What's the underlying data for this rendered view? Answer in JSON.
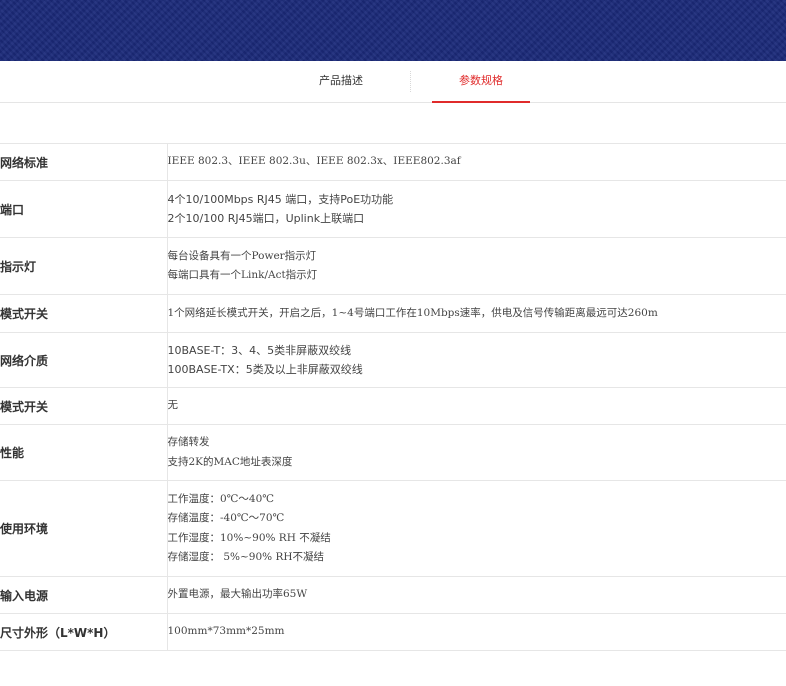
{
  "tabs": {
    "description": "产品描述",
    "specs": "参数规格"
  },
  "specs": [
    {
      "label": "网络标准",
      "lines": [
        "IEEE 802.3、IEEE 802.3u、IEEE 802.3x、IEEE802.3af"
      ]
    },
    {
      "label": "端口",
      "lines": [
        "4个10/100Mbps RJ45 端口，支持PoE功功能",
        "2个10/100 RJ45端口，Uplink上联端口"
      ]
    },
    {
      "label": "指示灯",
      "lines": [
        "每台设备具有一个Power指示灯",
        "每端口具有一个Link/Act指示灯"
      ]
    },
    {
      "label": "模式开关",
      "lines": [
        "1个网络延长模式开关，开启之后，1~4号端口工作在10Mbps速率，供电及信号传输距离最远可达260m"
      ]
    },
    {
      "label": "网络介质",
      "lines": [
        "10BASE-T：3、4、5类非屏蔽双绞线",
        "100BASE-TX：5类及以上非屏蔽双绞线"
      ]
    },
    {
      "label": "模式开关",
      "lines": [
        "无"
      ]
    },
    {
      "label": "性能",
      "lines": [
        "存储转发",
        "支持2K的MAC地址表深度"
      ]
    },
    {
      "label": "使用环境",
      "lines": [
        "工作温度：0℃～40℃",
        "存储温度：-40℃～70℃",
        "工作湿度：10%~90% RH 不凝结",
        "存储湿度： 5%~90% RH不凝结"
      ]
    },
    {
      "label": "输入电源",
      "lines": [
        "外置电源，最大输出功率65W"
      ]
    },
    {
      "label": "尺寸外形（L*W*H）",
      "lines": [
        "100mm*73mm*25mm"
      ]
    }
  ]
}
